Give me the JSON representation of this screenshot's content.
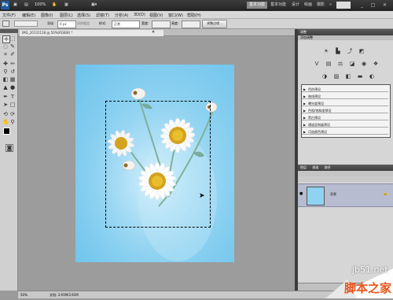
{
  "titlebar": {
    "logo": "Ps",
    "items": [
      "▣",
      "▤",
      "100%",
      "✋",
      "▦",
      "▣▾"
    ],
    "workspaces": [
      "基本功能",
      "基本功能",
      "设计",
      "绘画",
      "摄影"
    ],
    "more": "»",
    "win_buttons": [
      "_",
      "□",
      "✕"
    ]
  },
  "menubar": {
    "items": [
      "文件(F)",
      "编辑(E)",
      "图像(I)",
      "图层(L)",
      "选择(S)",
      "滤镜(T)",
      "分析(A)",
      "3D(D)",
      "视图(V)",
      "窗口(W)",
      "帮助(H)"
    ]
  },
  "optbar": {
    "feather_label": "羽化:",
    "feather_value": "0 px",
    "antialias": "消除锯齿",
    "style_label": "样式:",
    "style_value": "正常",
    "width_label": "宽度:",
    "height_label": "高度:",
    "refine_button": "调整边缘..."
  },
  "document": {
    "tab_label": "IMG_20131118 @ 50%(RGB/8) *",
    "close": "✕"
  },
  "statusbar": {
    "zoom": "50%",
    "doc": "文档: 3.91M/3.91M"
  },
  "panels": {
    "adjust_tab": "调整",
    "adjust_title": "添加调整",
    "presets": [
      "色阶预设",
      "曲线预设",
      "曝光度预设",
      "色相/饱和度预设",
      "黑白预设",
      "通道混和器预设",
      "可选颜色预设"
    ],
    "layers_tabs": [
      "图层",
      "通道",
      "路径"
    ],
    "layer_name": "背景",
    "eye": "●",
    "lock": "🔒"
  },
  "watermark": {
    "site": "jb51.net",
    "name": "脚本之家"
  },
  "colors": {
    "accent": "#1d5a9c",
    "sky": "#8fd2f1",
    "layer_selected": "#b7bcd1"
  }
}
